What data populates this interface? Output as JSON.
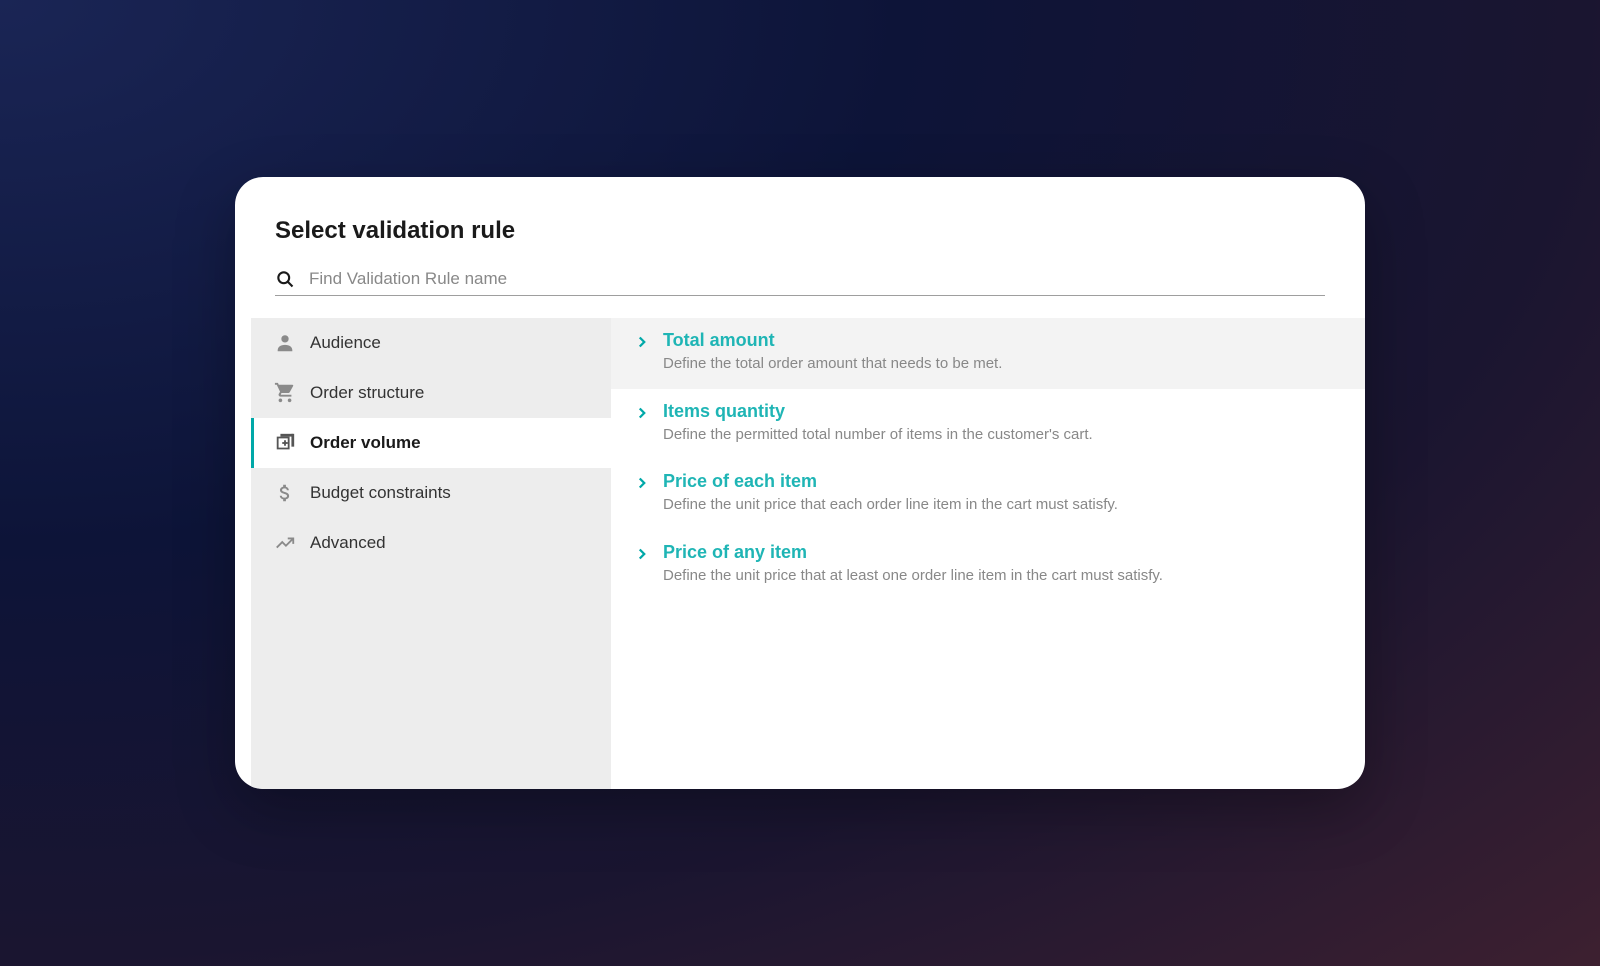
{
  "modal": {
    "title": "Select validation rule",
    "search": {
      "placeholder": "Find Validation Rule name"
    }
  },
  "sidebar": {
    "items": [
      {
        "label": "Audience",
        "icon": "person-icon",
        "active": false
      },
      {
        "label": "Order structure",
        "icon": "cart-icon",
        "active": false
      },
      {
        "label": "Order volume",
        "icon": "add-box-icon",
        "active": true
      },
      {
        "label": "Budget constraints",
        "icon": "dollar-icon",
        "active": false
      },
      {
        "label": "Advanced",
        "icon": "trend-icon",
        "active": false
      }
    ]
  },
  "rules": [
    {
      "title": "Total amount",
      "description": "Define the total order amount that needs to be met.",
      "hovered": true
    },
    {
      "title": "Items quantity",
      "description": "Define the permitted total number of items in the customer's cart.",
      "hovered": false
    },
    {
      "title": "Price of each item",
      "description": "Define the unit price that each order line item in the cart must satisfy.",
      "hovered": false
    },
    {
      "title": "Price of any item",
      "description": "Define the unit price that at least one order line item in the cart must satisfy.",
      "hovered": false
    }
  ]
}
